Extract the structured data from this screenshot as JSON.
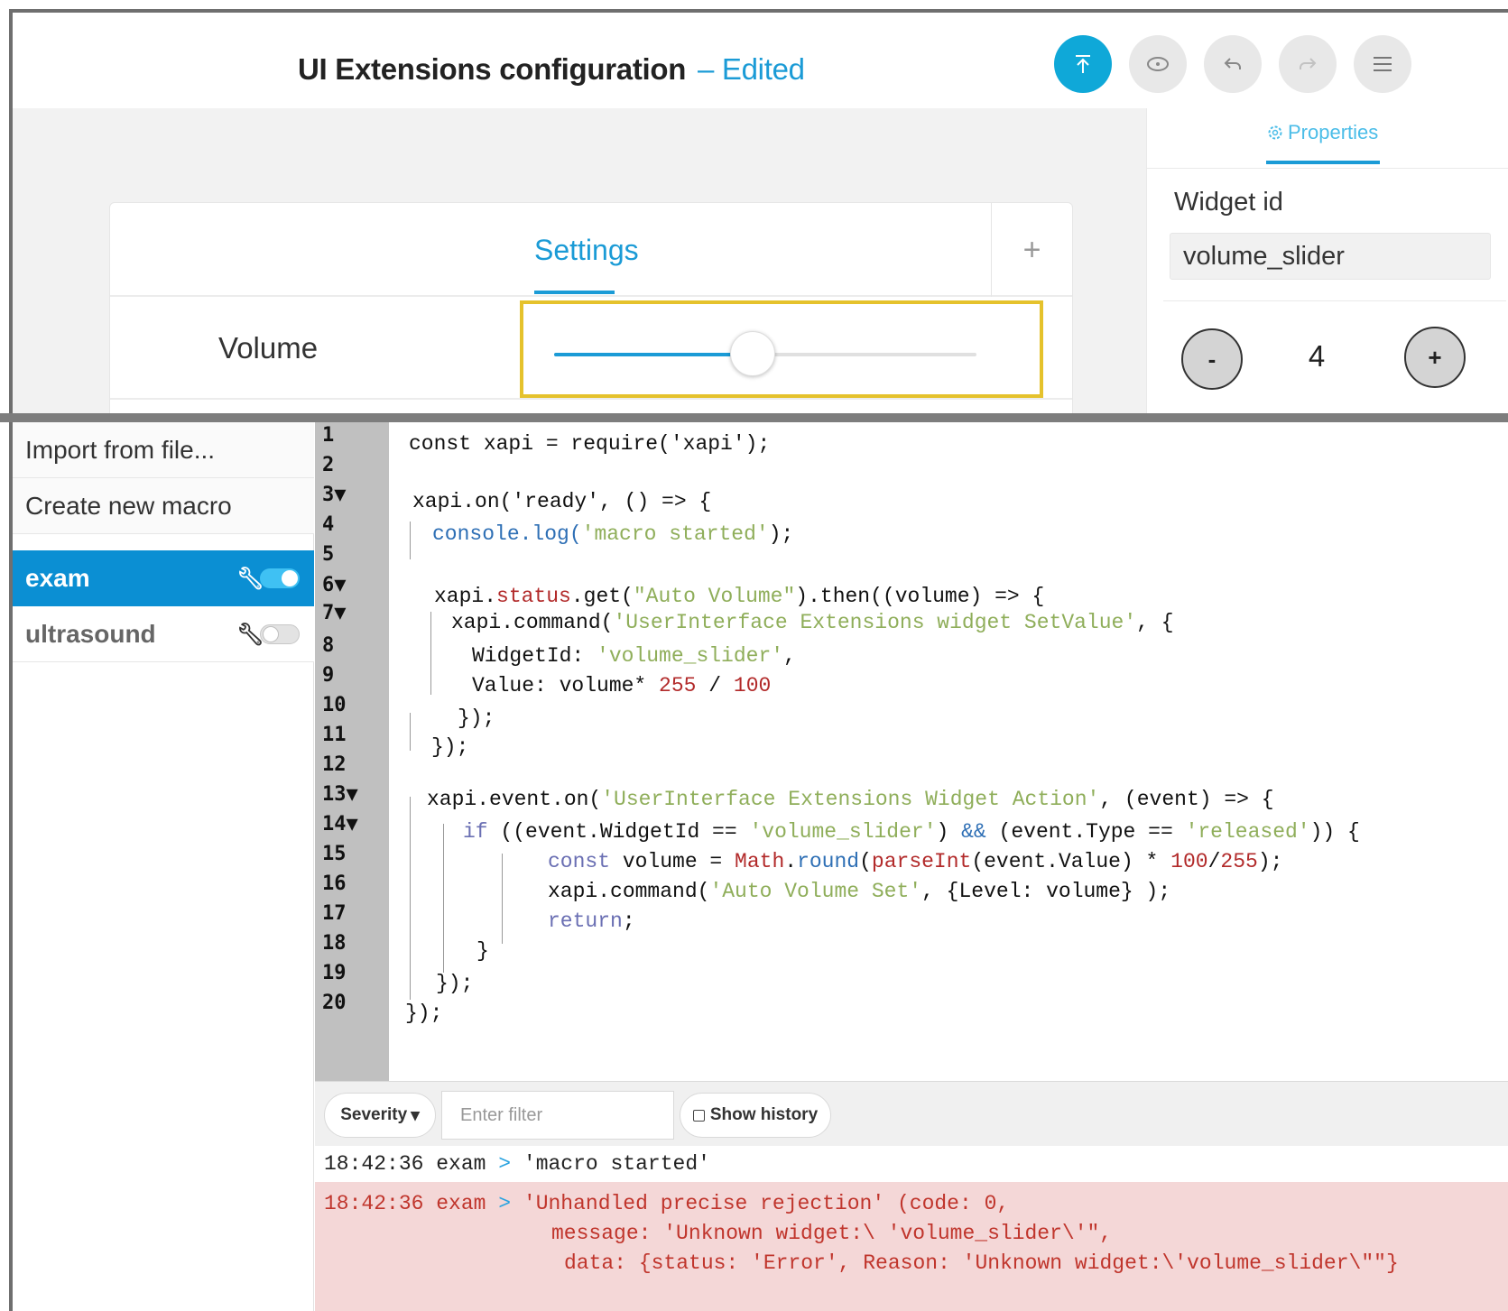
{
  "header": {
    "title": "UI Extensions configuration",
    "separator": "–",
    "status": "Edited",
    "buttons": [
      {
        "name": "upload",
        "icon": "upload-icon"
      },
      {
        "name": "preview",
        "icon": "eye-icon"
      },
      {
        "name": "undo",
        "icon": "undo-icon"
      },
      {
        "name": "redo",
        "icon": "redo-icon"
      },
      {
        "name": "menu",
        "icon": "hamburger-menu-icon"
      }
    ]
  },
  "panel": {
    "tab": "Settings",
    "add_symbol": "+",
    "row_label": "Volume",
    "slider_fraction": 0.47
  },
  "properties": {
    "tab": "Properties",
    "widget_id_label": "Widget id",
    "widget_id_value": "volume_slider",
    "minus": "-",
    "plus": "+",
    "step_value": "4"
  },
  "sidebar": {
    "import": "Import from file...",
    "create": "Create new macro",
    "macros": [
      {
        "name": "exam",
        "enabled": true,
        "active": true
      },
      {
        "name": "ultrasound",
        "enabled": false,
        "active": false
      }
    ]
  },
  "code": {
    "line_numbers": [
      "1",
      "2",
      "3▼",
      "4",
      "5",
      "6▼",
      "7▼",
      "8",
      "9",
      "10",
      "11",
      "12",
      "13▼",
      "14▼",
      "15",
      "16",
      "17",
      "18",
      "19",
      "20"
    ],
    "l1": "const xapi = require('xapi');",
    "l3a": "xapi.on(",
    "l3b": "'ready'",
    "l3c": ", () => {",
    "l4a": "console.log(",
    "l4b": "'macro started'",
    "l4c": ");",
    "l6a": "xapi.",
    "l6b": "status",
    "l6c": ".get(",
    "l6d": "\"Auto Volume\"",
    "l6e": ").then((volume) => {",
    "l7a": "xapi.command(",
    "l7b": "'UserInterface Extensions widget SetValue'",
    "l7c": ", {",
    "l8a": "WidgetId: ",
    "l8b": "'volume_slider'",
    "l8c": ",",
    "l9a": "Value: volume* ",
    "l9b": "255",
    "l9c": " / ",
    "l9d": "100",
    "l10": "});",
    "l11": "});",
    "l13a": "xapi.event.on(",
    "l13b": "'UserInterface Extensions Widget Action'",
    "l13c": ", (event) => {",
    "l14a": "if",
    "l14b": " ((event.WidgetId == ",
    "l14c": "'volume_slider'",
    "l14d": ") ",
    "l14e": "&&",
    "l14f": " (event.Type == ",
    "l14g": "'released'",
    "l14h": ")) {",
    "l15a": "const",
    "l15b": " volume = ",
    "l15c": "Math",
    "l15d": ".",
    "l15e": "round",
    "l15f": "(",
    "l15g": "parseInt",
    "l15h": "(event.Value) * ",
    "l15i": "100",
    "l15j": "/",
    "l15k": "255",
    "l15l": ");",
    "l16a": "xapi.command(",
    "l16b": "'Auto Volume Set'",
    "l16c": ", {Level: volume} );",
    "l17a": "return",
    "l17b": ";",
    "l18": "}",
    "l19": "});",
    "l20": "});"
  },
  "log": {
    "severity_label": "Severity",
    "filter_placeholder": "Enter filter",
    "show_history_label": "Show history",
    "info_time": "18:42:36",
    "info_macro": "exam",
    "arrow": ">",
    "info_msg": "'macro started'",
    "error_time": "18:42:36",
    "error_macro": "exam",
    "error_msg1": "'Unhandled precise rejection' (code: 0,",
    "error_msg2": "message: 'Unknown widget:\\ 'volume_slider\\'\",",
    "error_msg3": "data: {status: 'Error', Reason: 'Unknown widget:\\'volume_slider\\\"\"}"
  },
  "colors": {
    "accent": "#1b9bd6",
    "highlight": "#e5c22c",
    "error_bg": "#f4d7d7",
    "error_text": "#c0352c"
  }
}
